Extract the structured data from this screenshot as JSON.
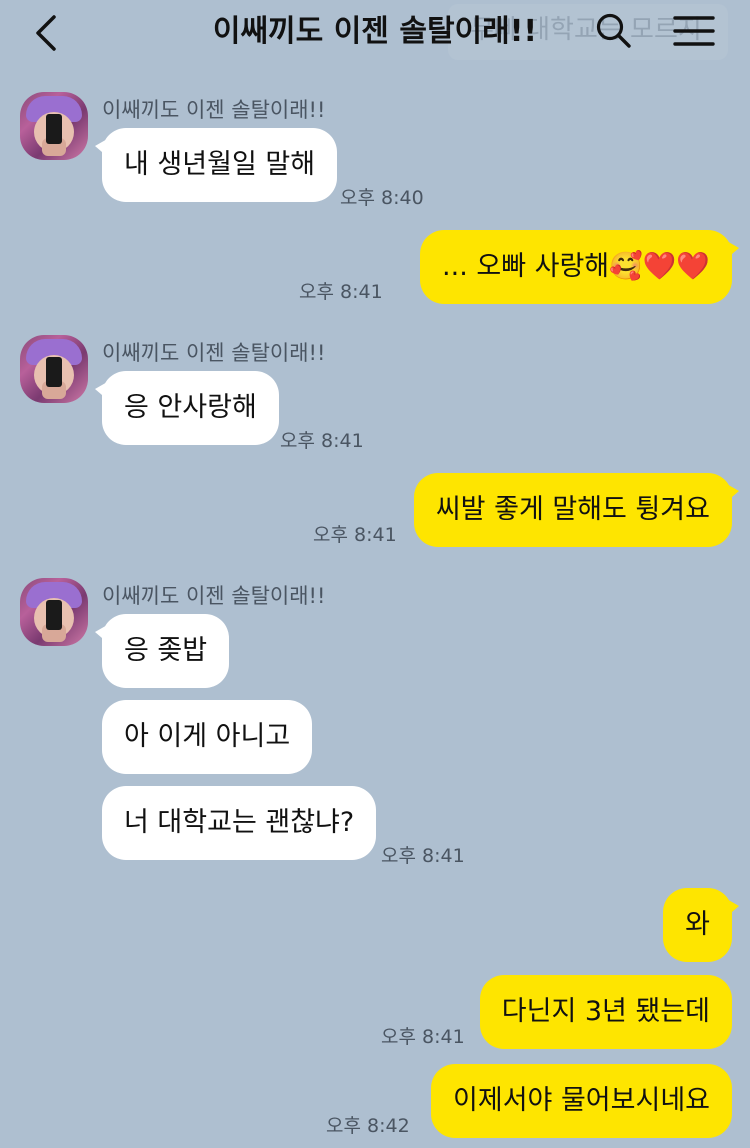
{
  "header": {
    "title": "이쌔끼도 이젠 솔탈이래!!",
    "ghost_banner": "무빠 대학교는 모르지"
  },
  "colors": {
    "background": "#aebfd0",
    "incoming_bubble": "#ffffff",
    "outgoing_bubble": "#fee500"
  },
  "icons": {
    "back": "back-arrow-icon",
    "search": "search-icon",
    "menu": "hamburger-menu-icon"
  },
  "messages": {
    "g1": {
      "sender": "이쌔끼도 이젠 솔탈이래!!",
      "m1": "내 생년월일 말해",
      "time": "오후 8:40"
    },
    "o1": {
      "m1": "... 오빠 사랑해🥰❤️❤️",
      "time": "오후 8:41"
    },
    "g2": {
      "sender": "이쌔끼도 이젠 솔탈이래!!",
      "m1": "응 안사랑해",
      "time": "오후 8:41"
    },
    "o2": {
      "m1": "씨발 좋게 말해도 튕겨요",
      "time": "오후 8:41"
    },
    "g3": {
      "sender": "이쌔끼도 이젠 솔탈이래!!",
      "m1": "응 좆밥",
      "m2": "아 이게 아니고",
      "m3": "너 대학교는 괜찮냐?",
      "time": "오후 8:41"
    },
    "o3": {
      "m1": "와",
      "m2": "다닌지 3년 됐는데",
      "time": "오후 8:41"
    },
    "o4": {
      "m1": "이제서야 물어보시네요",
      "time": "오후 8:42"
    }
  }
}
